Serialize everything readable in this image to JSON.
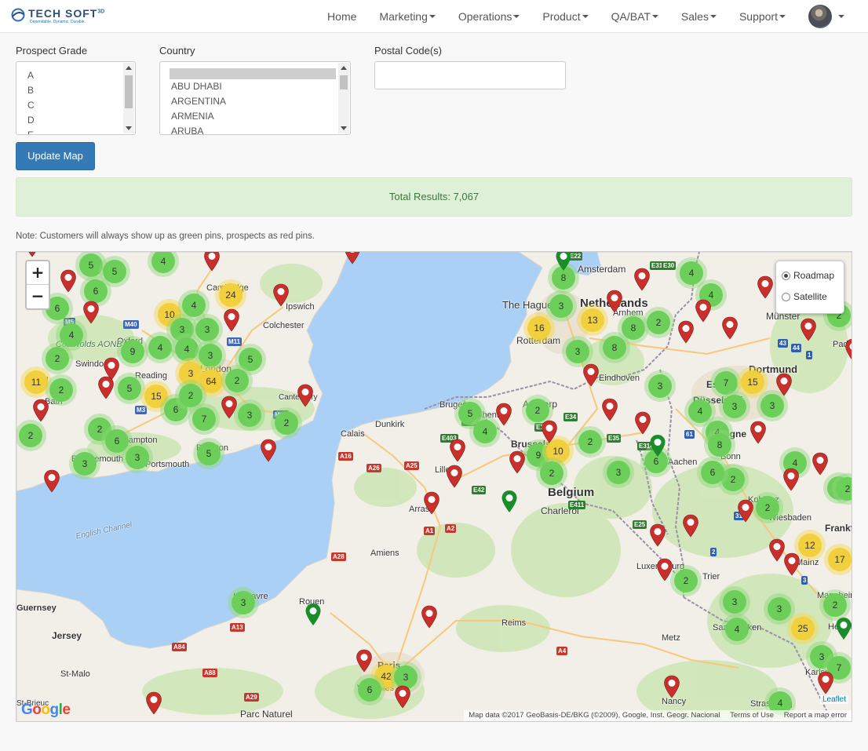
{
  "brand": {
    "name": "TECH SOFT",
    "superscript": "3D",
    "tagline": "Dependable. Dynamic. Durable."
  },
  "nav": {
    "items": [
      {
        "label": "Home",
        "dropdown": false
      },
      {
        "label": "Marketing",
        "dropdown": true
      },
      {
        "label": "Operations",
        "dropdown": true
      },
      {
        "label": "Product",
        "dropdown": true
      },
      {
        "label": "QA/BAT",
        "dropdown": true
      },
      {
        "label": "Sales",
        "dropdown": true
      },
      {
        "label": "Support",
        "dropdown": true
      }
    ]
  },
  "filters": {
    "grade_label": "Prospect Grade",
    "grade_options": [
      "A",
      "B",
      "C",
      "D",
      "E"
    ],
    "country_label": "Country",
    "country_options": [
      "",
      "ABU DHABI",
      "ARGENTINA",
      "ARMENIA",
      "ARUBA"
    ],
    "postal_label": "Postal Code(s)",
    "postal_value": ""
  },
  "update_button": "Update Map",
  "results": {
    "text": "Total Results: 7,067"
  },
  "note": "Note: Customers will always show up as green pins, prospects as red pins.",
  "map": {
    "zoom_in": "+",
    "zoom_out": "−",
    "layers": [
      "Roadmap",
      "Satellite"
    ],
    "selected_layer": "Roadmap",
    "leaflet": "Leaflet",
    "attribution": "Map data ©2017 GeoBasis-DE/BKG (©2009), Google, Inst. Geogr. Nacional",
    "terms": "Terms of Use",
    "report": "Report a map error",
    "google": "Google",
    "colors": {
      "sea": "#abd0f5",
      "land": "#f2efe9",
      "green_area": "#cfe6b8",
      "cluster_green": "#6ccf5a",
      "cluster_yellow": "#f2cf3c",
      "pin_red": "#c9302c",
      "pin_green": "#1a8d2b"
    },
    "places": [
      "Amsterdam",
      "Netherlands",
      "The Hague",
      "Rotterdam",
      "Münster",
      "Paderb",
      "Dortmund",
      "Essen",
      "Düsseldorf",
      "Eindhoven",
      "Antwerp",
      "Bruges",
      "Ghent",
      "Brussels",
      "Belgium",
      "Charleroi",
      "Aachen",
      "Bonn",
      "Cologne",
      "Koblenz",
      "Frankf",
      "Wiesbaden",
      "Mainz",
      "Trier",
      "Luxembourg",
      "Mannheim",
      "Heidelb",
      "Saarbrücken",
      "Metz",
      "Karlsruhe",
      "Nancy",
      "Strasbourg",
      "Reims",
      "Paris",
      "Versailles",
      "Rouen",
      "Le Havre",
      "Amiens",
      "Arras",
      "Lille",
      "Calais",
      "Dunkirk",
      "Canterbury",
      "Brighton",
      "Portsmouth",
      "Bournemouth",
      "Southampton",
      "London",
      "Reading",
      "Oxford",
      "Swindon",
      "Bath",
      "Bristol",
      "Cambridge",
      "Colchester",
      "Ipswich",
      "Cotswolds AONB",
      "English Channel",
      "Guernsey",
      "Jersey",
      "St-Malo",
      "Parc Naturel",
      "St-Brieuc",
      "Arnhem"
    ],
    "roads": [
      "E22",
      "E31",
      "E30",
      "E34",
      "E19",
      "E40",
      "E403",
      "E42",
      "E411",
      "E25",
      "E314",
      "E35",
      "A16",
      "A26",
      "A25",
      "A1",
      "A2",
      "A28",
      "A13",
      "A84",
      "A88",
      "A29",
      "A4",
      "M40",
      "M11",
      "M3",
      "M20",
      "M5",
      "43",
      "44",
      "1",
      "2",
      "3",
      "31",
      "61"
    ],
    "clusters": [
      {
        "v": "5",
        "c": "g"
      },
      {
        "v": "5",
        "c": "g"
      },
      {
        "v": "4",
        "c": "g"
      },
      {
        "v": "6",
        "c": "g"
      },
      {
        "v": "6",
        "c": "g"
      },
      {
        "v": "24",
        "c": "y"
      },
      {
        "v": "10",
        "c": "y"
      },
      {
        "v": "4",
        "c": "g"
      },
      {
        "v": "3",
        "c": "g"
      },
      {
        "v": "3",
        "c": "g"
      },
      {
        "v": "4",
        "c": "g"
      },
      {
        "v": "9",
        "c": "g"
      },
      {
        "v": "4",
        "c": "g"
      },
      {
        "v": "3",
        "c": "g"
      },
      {
        "v": "5",
        "c": "g"
      },
      {
        "v": "4",
        "c": "g"
      },
      {
        "v": "2",
        "c": "g"
      },
      {
        "v": "11",
        "c": "y"
      },
      {
        "v": "2",
        "c": "g"
      },
      {
        "v": "5",
        "c": "g"
      },
      {
        "v": "15",
        "c": "y"
      },
      {
        "v": "3",
        "c": "y"
      },
      {
        "v": "64",
        "c": "y"
      },
      {
        "v": "2",
        "c": "g"
      },
      {
        "v": "6",
        "c": "g"
      },
      {
        "v": "2",
        "c": "g"
      },
      {
        "v": "7",
        "c": "g"
      },
      {
        "v": "3",
        "c": "g"
      },
      {
        "v": "2",
        "c": "g"
      },
      {
        "v": "2",
        "c": "g"
      },
      {
        "v": "2",
        "c": "g"
      },
      {
        "v": "6",
        "c": "g"
      },
      {
        "v": "3",
        "c": "g"
      },
      {
        "v": "3",
        "c": "g"
      },
      {
        "v": "5",
        "c": "g"
      },
      {
        "v": "8",
        "c": "g"
      },
      {
        "v": "3",
        "c": "g"
      },
      {
        "v": "16",
        "c": "y"
      },
      {
        "v": "13",
        "c": "y"
      },
      {
        "v": "8",
        "c": "g"
      },
      {
        "v": "2",
        "c": "g"
      },
      {
        "v": "4",
        "c": "g"
      },
      {
        "v": "4",
        "c": "g"
      },
      {
        "v": "3",
        "c": "g"
      },
      {
        "v": "8",
        "c": "g"
      },
      {
        "v": "3",
        "c": "g"
      },
      {
        "v": "7",
        "c": "g"
      },
      {
        "v": "15",
        "c": "y"
      },
      {
        "v": "3",
        "c": "g"
      },
      {
        "v": "4",
        "c": "g"
      },
      {
        "v": "3",
        "c": "g"
      },
      {
        "v": "2",
        "c": "g"
      },
      {
        "v": "2",
        "c": "g"
      },
      {
        "v": "5",
        "c": "g"
      },
      {
        "v": "4",
        "c": "g"
      },
      {
        "v": "9",
        "c": "g"
      },
      {
        "v": "10",
        "c": "y"
      },
      {
        "v": "2",
        "c": "g"
      },
      {
        "v": "2",
        "c": "g"
      },
      {
        "v": "3",
        "c": "g"
      },
      {
        "v": "6",
        "c": "g"
      },
      {
        "v": "4",
        "c": "g"
      },
      {
        "v": "8",
        "c": "g"
      },
      {
        "v": "2",
        "c": "g"
      },
      {
        "v": "6",
        "c": "g"
      },
      {
        "v": "4",
        "c": "g"
      },
      {
        "v": "2",
        "c": "g"
      },
      {
        "v": "3",
        "c": "g"
      },
      {
        "v": "12",
        "c": "y"
      },
      {
        "v": "17",
        "c": "y"
      },
      {
        "v": "2",
        "c": "g"
      },
      {
        "v": "3",
        "c": "g"
      },
      {
        "v": "2",
        "c": "g"
      },
      {
        "v": "4",
        "c": "g"
      },
      {
        "v": "3",
        "c": "g"
      },
      {
        "v": "25",
        "c": "y"
      },
      {
        "v": "3",
        "c": "g"
      },
      {
        "v": "7",
        "c": "g"
      },
      {
        "v": "3",
        "c": "g"
      },
      {
        "v": "42",
        "c": "y"
      },
      {
        "v": "6",
        "c": "g"
      },
      {
        "v": "3",
        "c": "g"
      },
      {
        "v": "4",
        "c": "g"
      },
      {
        "v": "2",
        "c": "g"
      }
    ],
    "pins": [
      {
        "c": "r"
      },
      {
        "c": "r"
      },
      {
        "c": "r"
      },
      {
        "c": "r"
      },
      {
        "c": "r"
      },
      {
        "c": "r"
      },
      {
        "c": "r"
      },
      {
        "c": "r"
      },
      {
        "c": "r"
      },
      {
        "c": "r"
      },
      {
        "c": "r"
      },
      {
        "c": "r"
      },
      {
        "c": "r"
      },
      {
        "c": "r"
      },
      {
        "c": "r"
      },
      {
        "c": "r"
      },
      {
        "c": "r"
      },
      {
        "c": "r"
      },
      {
        "c": "r"
      },
      {
        "c": "r"
      },
      {
        "c": "r"
      },
      {
        "c": "r"
      },
      {
        "c": "r"
      },
      {
        "c": "r"
      },
      {
        "c": "r"
      },
      {
        "c": "r"
      },
      {
        "c": "r"
      },
      {
        "c": "r"
      },
      {
        "c": "r"
      },
      {
        "c": "r"
      },
      {
        "c": "r"
      },
      {
        "c": "r"
      },
      {
        "c": "r"
      },
      {
        "c": "r"
      },
      {
        "c": "r"
      },
      {
        "c": "r"
      },
      {
        "c": "r"
      },
      {
        "c": "r"
      },
      {
        "c": "r"
      },
      {
        "c": "r"
      },
      {
        "c": "r"
      },
      {
        "c": "r"
      },
      {
        "c": "r"
      },
      {
        "c": "r"
      },
      {
        "c": "r"
      },
      {
        "c": "r"
      },
      {
        "c": "r"
      },
      {
        "c": "g"
      },
      {
        "c": "g"
      },
      {
        "c": "g"
      },
      {
        "c": "g"
      },
      {
        "c": "g"
      }
    ]
  }
}
